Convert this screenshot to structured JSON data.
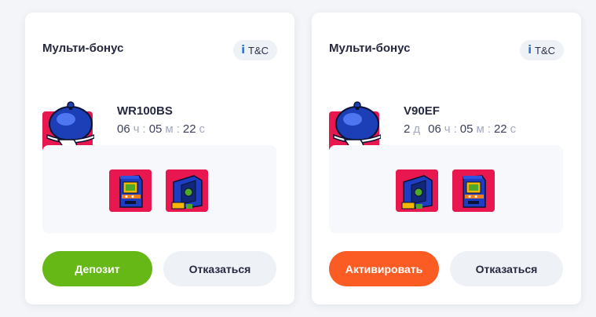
{
  "cards": [
    {
      "title": "Мульти-бонус",
      "tc_label": "T&C",
      "tc_icon": "info-icon",
      "code": "WR100BS",
      "timer": {
        "hours": "06",
        "hours_unit": "ч",
        "minutes": "05",
        "minutes_unit": "м",
        "seconds": "22",
        "seconds_unit": "с"
      },
      "games": [
        {
          "icon": "arcade-cabinet-icon"
        },
        {
          "icon": "safe-vault-icon"
        }
      ],
      "primary_button": {
        "label": "Депозит",
        "color": "#66b817"
      },
      "secondary_button": {
        "label": "Отказаться"
      }
    },
    {
      "title": "Мульти-бонус",
      "tc_label": "T&C",
      "tc_icon": "info-icon",
      "code": "V90EF",
      "timer": {
        "days": "2",
        "days_unit": "д",
        "hours": "06",
        "hours_unit": "ч",
        "minutes": "05",
        "minutes_unit": "м",
        "seconds": "22",
        "seconds_unit": "с"
      },
      "games": [
        {
          "icon": "safe-vault-icon"
        },
        {
          "icon": "arcade-cabinet-icon"
        }
      ],
      "primary_button": {
        "label": "Активировать",
        "color": "#fb5c23"
      },
      "secondary_button": {
        "label": "Отказаться"
      }
    }
  ],
  "colors": {
    "accent_green": "#66b817",
    "accent_orange": "#fb5c23",
    "info_blue": "#2d6fd8",
    "tile_red": "#e8174f"
  }
}
